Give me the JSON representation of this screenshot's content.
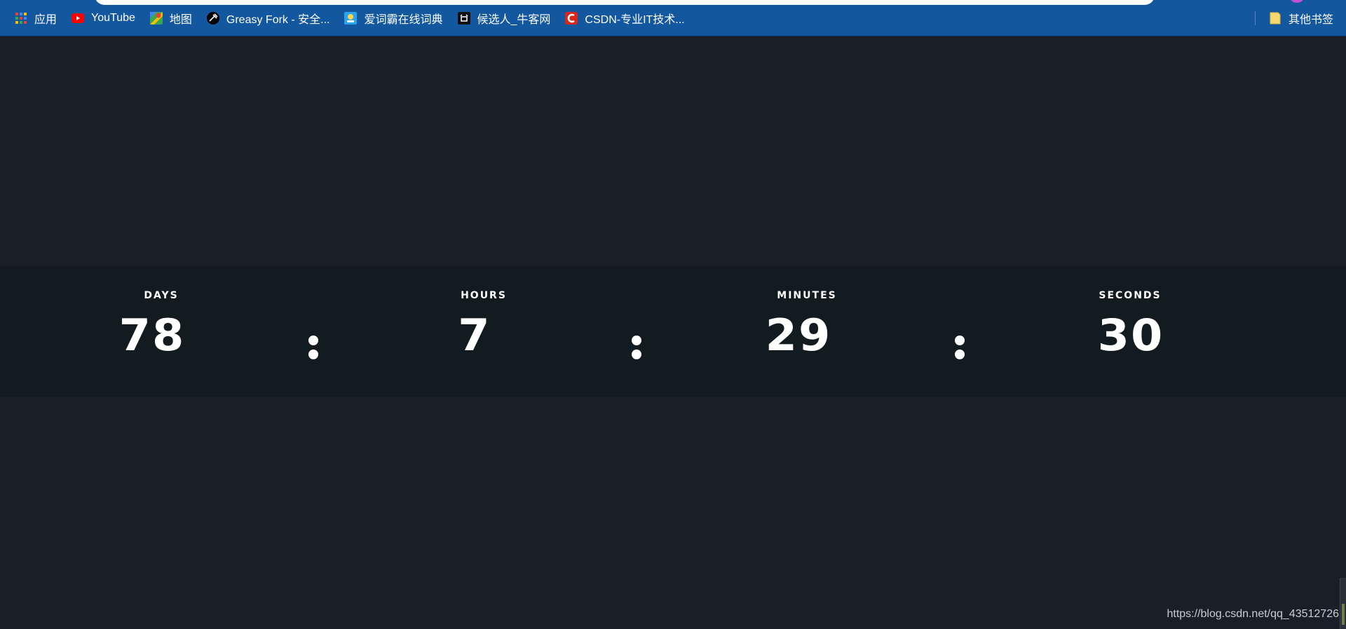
{
  "bookmarks_bar": {
    "items": [
      {
        "label": "应用",
        "icon": "apps-grid-icon"
      },
      {
        "label": "YouTube",
        "icon": "youtube-icon"
      },
      {
        "label": "地图",
        "icon": "maps-icon"
      },
      {
        "label": "Greasy Fork - 安全...",
        "icon": "greasy-fork-icon"
      },
      {
        "label": "爱词霸在线词典",
        "icon": "iciba-icon"
      },
      {
        "label": "候选人_牛客网",
        "icon": "nowcoder-icon"
      },
      {
        "label": "CSDN-专业IT技术...",
        "icon": "csdn-icon"
      }
    ],
    "other_bookmarks": {
      "label": "其他书签",
      "icon": "folder-icon"
    },
    "colors": {
      "background": "#13579f",
      "text": "#ffffff"
    }
  },
  "countdown": {
    "units": [
      {
        "label": "DAYS",
        "value": "78"
      },
      {
        "label": "HOURS",
        "value": "7"
      },
      {
        "label": "MINUTES",
        "value": "29"
      },
      {
        "label": "SECONDS",
        "value": "30"
      }
    ],
    "separator": ":",
    "colors": {
      "band": "#111b20",
      "page": "#1a1f27",
      "text": "#ffffff"
    }
  },
  "watermark": {
    "text": "https://blog.csdn.net/qq_43512726"
  }
}
